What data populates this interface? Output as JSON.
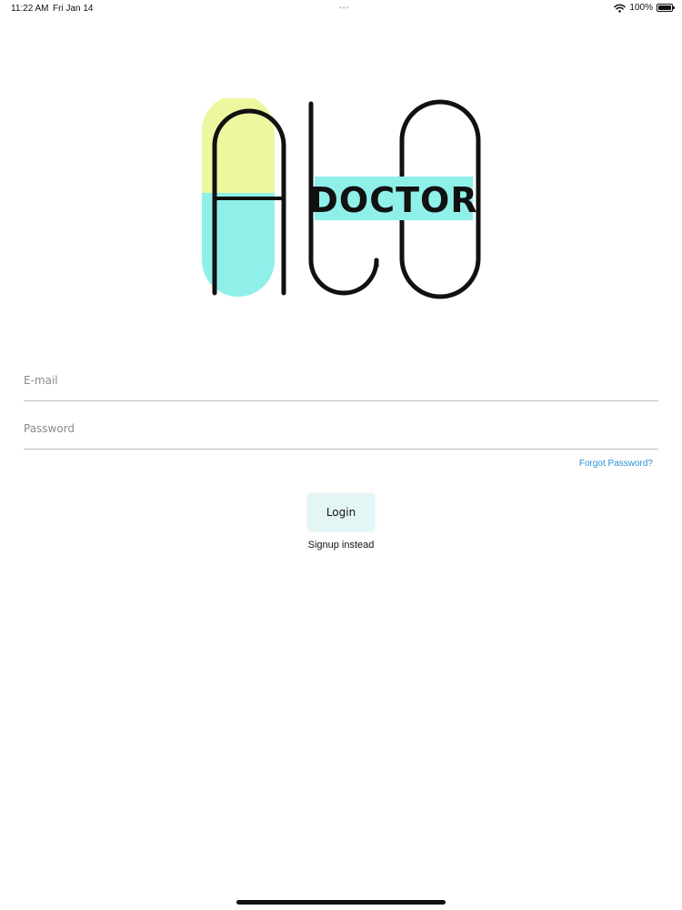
{
  "status_bar": {
    "time": "11:22 AM",
    "date": "Fri Jan 14",
    "battery": "100%",
    "battery_level": 1.0
  },
  "logo": {
    "text": "DOCTOR",
    "colors": {
      "pill_top": "#ecf7a0",
      "pill_bottom": "#8ff0ea",
      "banner": "#8ff0ea",
      "stroke": "#111111"
    }
  },
  "form": {
    "email": {
      "placeholder": "E-mail",
      "value": ""
    },
    "password": {
      "placeholder": "Password",
      "value": ""
    },
    "forgot_label": "Forgot Password?",
    "login_label": "Login",
    "signup_label": "Signup instead"
  },
  "colors": {
    "link": "#2a8fd6",
    "button_bg": "#e4f5f6",
    "divider": "#bdbdbd"
  }
}
